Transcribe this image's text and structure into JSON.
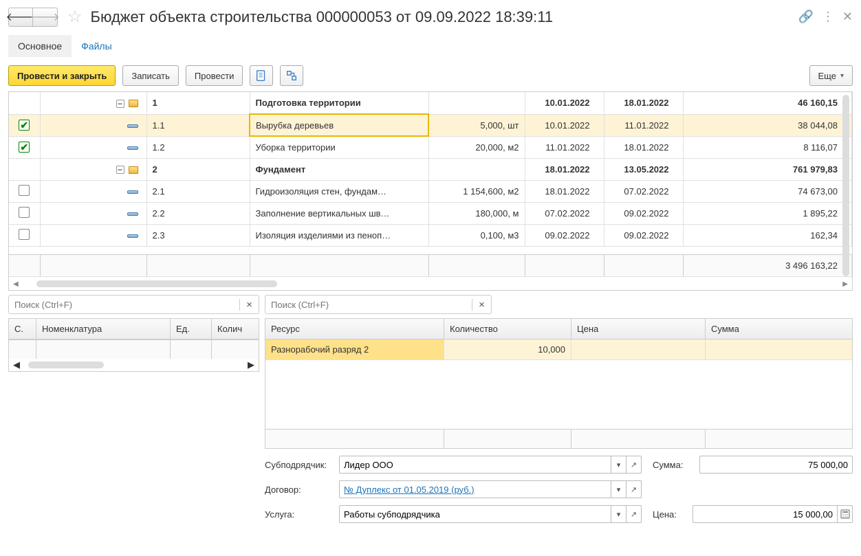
{
  "header": {
    "title": "Бюджет объекта строительства 000000053 от 09.09.2022 18:39:11"
  },
  "tabs": {
    "main": "Основное",
    "files": "Файлы"
  },
  "toolbar": {
    "post_close": "Провести и закрыть",
    "save": "Записать",
    "post": "Провести",
    "more": "Еще"
  },
  "tree": {
    "rows": [
      {
        "type": "folder",
        "code": "1",
        "name": "Подготовка территории",
        "qty": "",
        "d1": "10.01.2022",
        "d2": "18.01.2022",
        "sum": "46 160,15",
        "checked": null,
        "bold": true
      },
      {
        "type": "item",
        "code": "1.1",
        "name": "Вырубка деревьев",
        "qty": "5,000, шт",
        "d1": "10.01.2022",
        "d2": "11.01.2022",
        "sum": "38 044,08",
        "checked": true,
        "selected": true,
        "active_name": true
      },
      {
        "type": "item",
        "code": "1.2",
        "name": "Уборка территории",
        "qty": "20,000, м2",
        "d1": "11.01.2022",
        "d2": "18.01.2022",
        "sum": "8 116,07",
        "checked": true
      },
      {
        "type": "folder",
        "code": "2",
        "name": "Фундамент",
        "qty": "",
        "d1": "18.01.2022",
        "d2": "13.05.2022",
        "sum": "761 979,83",
        "checked": null,
        "bold": true
      },
      {
        "type": "item",
        "code": "2.1",
        "name": "Гидроизоляция стен, фундам…",
        "qty": "1 154,600, м2",
        "d1": "18.01.2022",
        "d2": "07.02.2022",
        "sum": "74 673,00",
        "checked": false
      },
      {
        "type": "item",
        "code": "2.2",
        "name": "Заполнение вертикальных шв…",
        "qty": "180,000, м",
        "d1": "07.02.2022",
        "d2": "09.02.2022",
        "sum": "1 895,22",
        "checked": false
      },
      {
        "type": "item",
        "code": "2.3",
        "name": "Изоляция изделиями из пеноп…",
        "qty": "0,100, м3",
        "d1": "09.02.2022",
        "d2": "09.02.2022",
        "sum": "162,34",
        "checked": false
      }
    ],
    "total": "3 496 163,22"
  },
  "search": {
    "placeholder": "Поиск (Ctrl+F)"
  },
  "left_grid": {
    "cols": {
      "s": "С.",
      "nom": "Номенклатура",
      "ed": "Ед.",
      "qty": "Колич"
    }
  },
  "right_grid": {
    "cols": {
      "res": "Ресурс",
      "qty": "Количество",
      "price": "Цена",
      "sum": "Сумма"
    },
    "row": {
      "res": "Разнорабочий разряд 2",
      "qty": "10,000",
      "price": "",
      "sum": ""
    }
  },
  "form": {
    "sub_label": "Субподрядчик:",
    "sub_value": "Лидер ООО",
    "sum_label": "Сумма:",
    "sum_value": "75 000,00",
    "contract_label": "Договор:",
    "contract_value": "№ Дуплекс от 01.05.2019 (руб.)",
    "service_label": "Услуга:",
    "service_value": "Работы субподрядчика",
    "price_label": "Цена:",
    "price_value": "15 000,00"
  }
}
